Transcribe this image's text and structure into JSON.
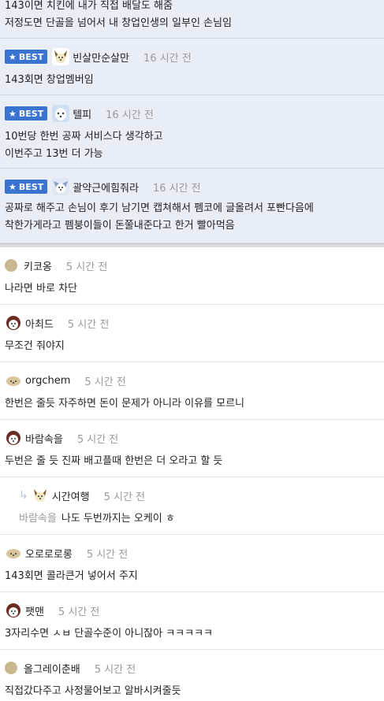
{
  "best_label": "BEST",
  "top_partial": {
    "lines": [
      "143이면 치킨에 내가 직접 배달도 해줌",
      "저정도면 단골을 넘어서 내 창업인생의 일부인 손님임"
    ]
  },
  "best_comments": [
    {
      "nick": "빈살만순살만",
      "time": "16 시간 전",
      "lines": [
        "143회면 창업멤버임"
      ],
      "avatar": "dog-avatar"
    },
    {
      "nick": "텔피",
      "time": "16 시간 전",
      "lines": [
        "10번당 한번 공짜 서비스다 생각하고",
        "이번주고 13번 더 가능"
      ],
      "avatar": "dog-avatar-blue"
    },
    {
      "nick": "괄약근에힘줘라",
      "time": "16 시간 전",
      "lines": [
        "공짜로 해주고 손님이 후기 남기면 캡쳐해서 펨코에 글올려서 포빤다음에",
        "착한가게라고 펨붕이들이 돈쭐내준다고 한거 빨아먹음"
      ],
      "avatar": "dog-avatar-gray"
    }
  ],
  "comments": [
    {
      "nick": "키코옹",
      "time": "5 시간 전",
      "text": "나라면 바로 차단",
      "avatar": "dot"
    },
    {
      "nick": "아최드",
      "time": "5 시간 전",
      "text": "무조건 줘야지",
      "avatar": "dog-avatar-red"
    },
    {
      "nick": "orgchem",
      "time": "5 시간 전",
      "text": "한번은 줄듯 자주하면 돈이 문제가 아니라 이유를 모르니",
      "avatar": "dog-avatar-tan"
    },
    {
      "nick": "바람속을",
      "time": "5 시간 전",
      "text": "두번은 줄 듯 진짜 배고플때 한번은 더 오라고 할 듯",
      "avatar": "dog-avatar-red"
    }
  ],
  "reply": {
    "nick": "시간여행",
    "time": "5 시간 전",
    "mention": "바람속을",
    "text": "나도 두번까지는 오케이 ㅎ",
    "avatar": "dog-avatar"
  },
  "comments2": [
    {
      "nick": "오로로로롱",
      "time": "5 시간 전",
      "text": "143회면 콜라큰거 넣어서 주지",
      "avatar": "dog-avatar-tan"
    },
    {
      "nick": "팻맨",
      "time": "5 시간 전",
      "text": "3자리수면 ㅅㅂ 단골수준이 아니잖아 ㅋㅋㅋㅋㅋ",
      "avatar": "dog-avatar-red"
    },
    {
      "nick": "올그레이춘배",
      "time": "5 시간 전",
      "text": "직접갔다주고 사정물어보고 알바시켜줄듯",
      "avatar": "dot"
    }
  ]
}
